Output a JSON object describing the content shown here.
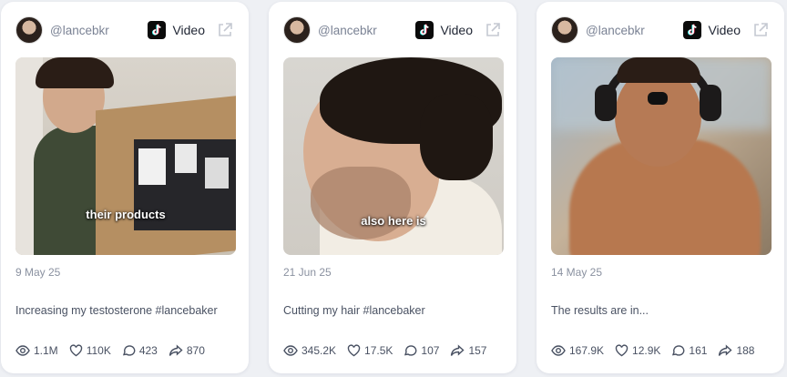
{
  "cards": [
    {
      "handle": "@lancebkr",
      "platform": "Video",
      "platform_icon": "tiktok-icon",
      "overlay_text": "their products",
      "date": "9 May 25",
      "description": "Increasing my testosterone #lancebaker",
      "views": "1.1M",
      "likes": "110K",
      "comments": "423",
      "shares": "870"
    },
    {
      "handle": "@lancebkr",
      "platform": "Video",
      "platform_icon": "tiktok-icon",
      "overlay_text": "also here is",
      "date": "21 Jun 25",
      "description": "Cutting my hair #lancebaker",
      "views": "345.2K",
      "likes": "17.5K",
      "comments": "107",
      "shares": "157"
    },
    {
      "handle": "@lancebkr",
      "platform": "Video",
      "platform_icon": "tiktok-icon",
      "overlay_text": "",
      "date": "14 May 25",
      "description": "The results are in...",
      "views": "167.9K",
      "likes": "12.9K",
      "comments": "161",
      "shares": "188"
    }
  ],
  "colors": {
    "background": "#eef0f4",
    "card": "#ffffff",
    "muted_text": "#8a91a0",
    "body_text": "#4a5263"
  }
}
